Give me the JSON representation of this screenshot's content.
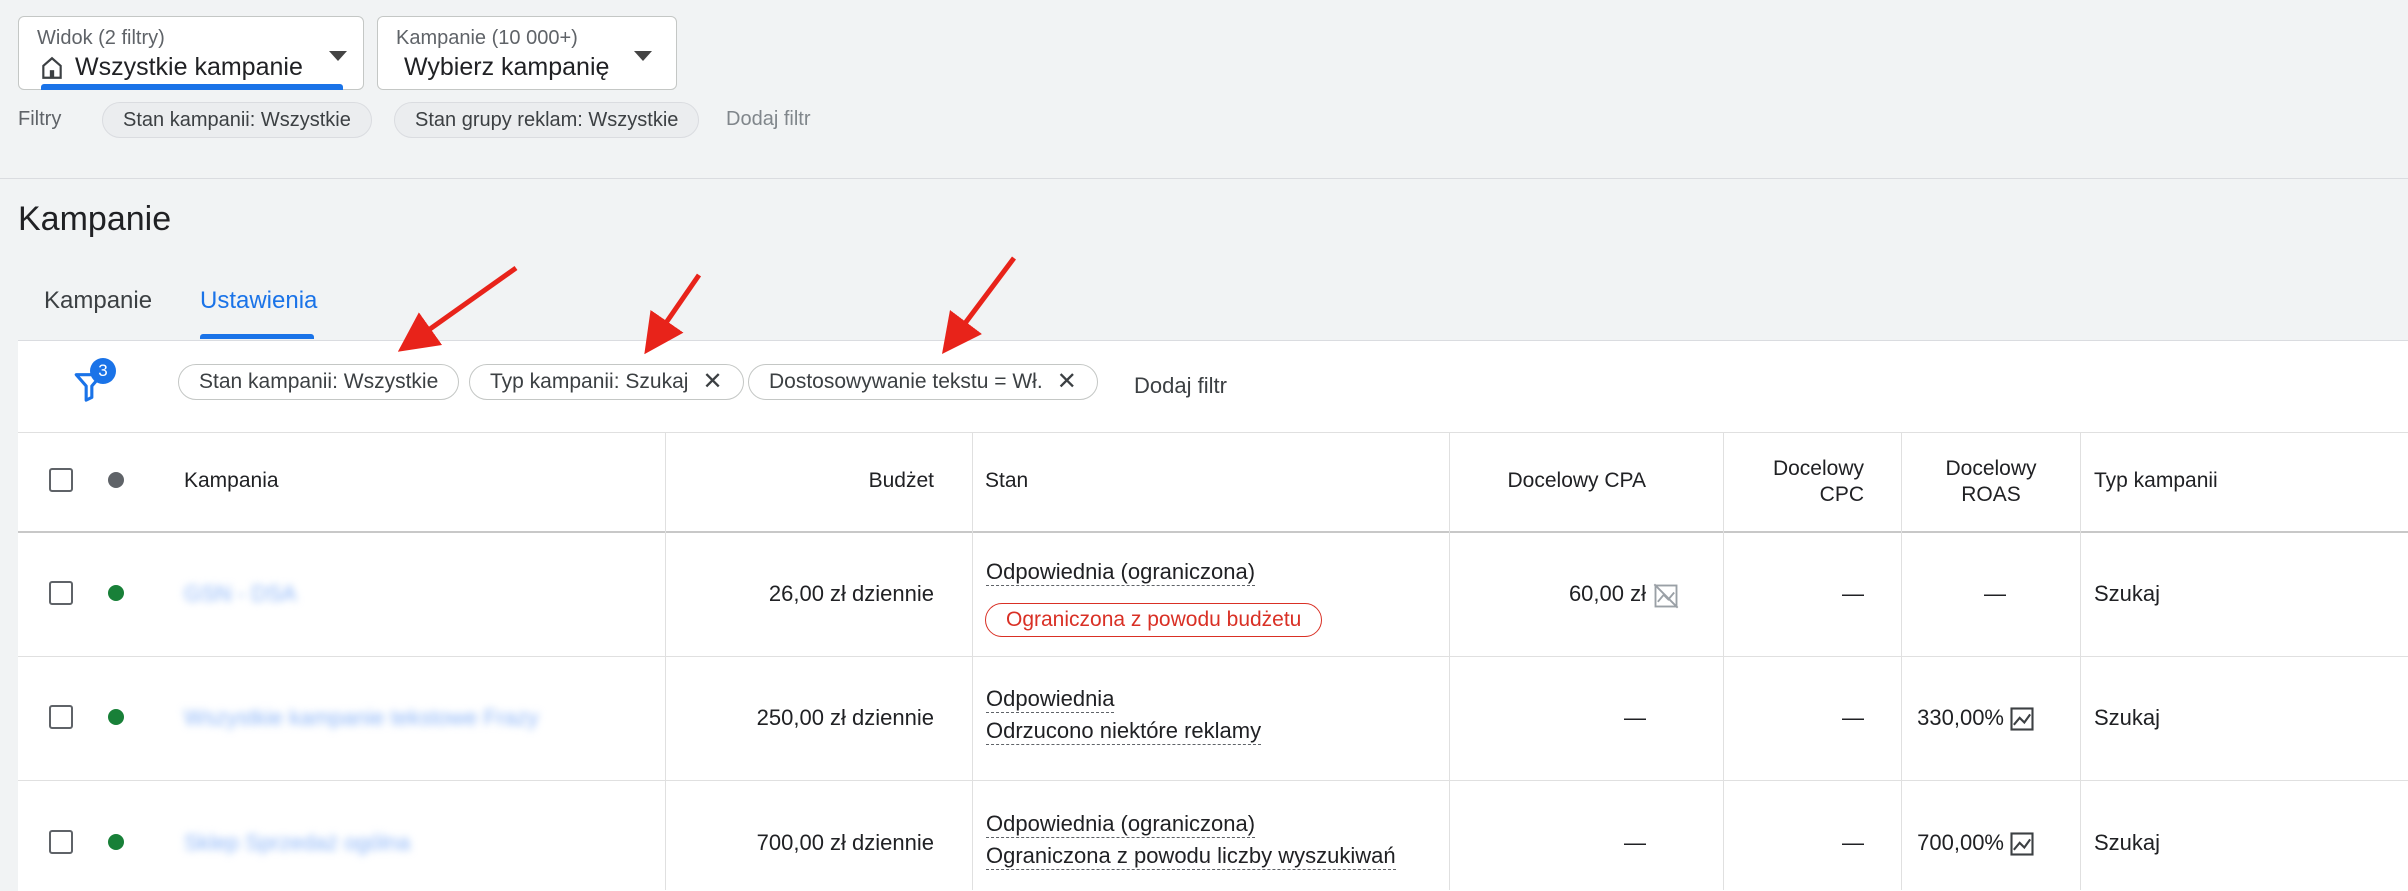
{
  "view_selector": {
    "sub": "Widok (2 filtry)",
    "main": "Wszystkie kampanie"
  },
  "campaign_selector": {
    "sub": "Kampanie (10 000+)",
    "main": "Wybierz kampanię"
  },
  "top_filters": {
    "label": "Filtry",
    "chips": [
      "Stan kampanii: Wszystkie",
      "Stan grupy reklam: Wszystkie"
    ],
    "add": "Dodaj filtr"
  },
  "page_title": "Kampanie",
  "tabs": [
    {
      "label": "Kampanie"
    },
    {
      "label": "Ustawienia"
    }
  ],
  "active_tab": "Ustawienia",
  "filter_bar": {
    "badge": "3",
    "chips": [
      {
        "label": "Stan kampanii: Wszystkie"
      },
      {
        "label": "Typ kampanii: Szukaj"
      },
      {
        "label": "Dostosowywanie tekstu = Wł."
      }
    ],
    "add": "Dodaj filtr"
  },
  "table": {
    "headers": {
      "campaign": "Kampania",
      "budget": "Budżet",
      "status": "Stan",
      "cpa": "Docelowy CPA",
      "cpc": [
        "Docelowy",
        "CPC"
      ],
      "roas": [
        "Docelowy",
        "ROAS"
      ],
      "type": "Typ kampanii"
    },
    "rows": [
      {
        "name": "GSN - DSA",
        "budget": "26,00 zł dziennie",
        "status_primary": "Odpowiednia (ograniczona)",
        "status_pill": "Ograniczona z powodu budżetu",
        "cpa": "60,00 zł",
        "cpc": "—",
        "roas": "—",
        "type": "Szukaj",
        "status_color": "#188038"
      },
      {
        "name": "Wszystkie kampanie tekstowe Frazy",
        "budget": "250,00 zł dziennie",
        "status_primary": "Odpowiednia",
        "status_secondary": "Odrzucono niektóre reklamy",
        "cpa": "—",
        "cpc": "—",
        "roas": "330,00%",
        "type": "Szukaj",
        "status_color": "#188038"
      },
      {
        "name": "Sklep Sprzedaż ogólna",
        "budget": "700,00 zł dziennie",
        "status_primary": "Odpowiednia (ograniczona)",
        "status_secondary": "Ograniczona z powodu liczby wyszukiwań",
        "cpa": "—",
        "cpc": "—",
        "roas": "700,00%",
        "type": "Szukaj",
        "status_color": "#188038"
      }
    ]
  },
  "colors": {
    "accent": "#1a73e8",
    "enabled": "#188038",
    "warning": "#d93025",
    "annotation_arrow": "#e8231a"
  }
}
